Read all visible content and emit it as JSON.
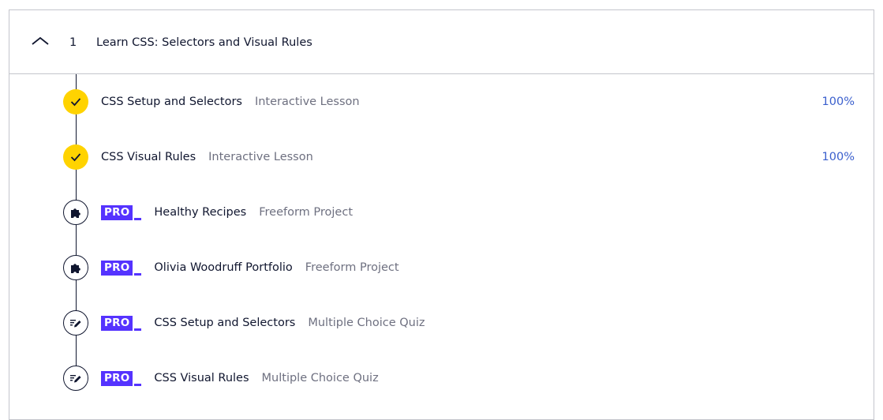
{
  "module": {
    "number": "1",
    "title": "Learn CSS: Selectors and Visual Rules",
    "expanded": true,
    "icon": "chevron-up-icon"
  },
  "pro_badge_label": "PRO",
  "colors": {
    "completed": "#ffd300",
    "pro": "#5533ff",
    "progress": "#3a5fcd",
    "muted": "#6e7080",
    "text": "#10162f"
  },
  "items": [
    {
      "title": "CSS Setup and Selectors",
      "type": "Interactive Lesson",
      "progress": "100%",
      "status": "completed",
      "icon": "check-icon",
      "pro": false
    },
    {
      "title": "CSS Visual Rules",
      "type": "Interactive Lesson",
      "progress": "100%",
      "status": "completed",
      "icon": "check-icon",
      "pro": false
    },
    {
      "title": "Healthy Recipes",
      "type": "Freeform Project",
      "progress": "",
      "status": "locked",
      "icon": "puzzle-icon",
      "pro": true
    },
    {
      "title": "Olivia Woodruff Portfolio",
      "type": "Freeform Project",
      "progress": "",
      "status": "locked",
      "icon": "puzzle-icon",
      "pro": true
    },
    {
      "title": "CSS Setup and Selectors",
      "type": "Multiple Choice Quiz",
      "progress": "",
      "status": "locked",
      "icon": "quiz-pencil-icon",
      "pro": true
    },
    {
      "title": "CSS Visual Rules",
      "type": "Multiple Choice Quiz",
      "progress": "",
      "status": "locked",
      "icon": "quiz-pencil-icon",
      "pro": true
    }
  ]
}
